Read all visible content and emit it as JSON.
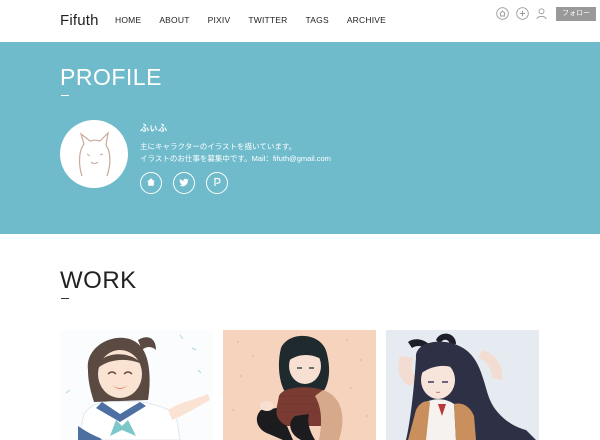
{
  "header": {
    "brand": "Fifuth",
    "nav": [
      "HOME",
      "ABOUT",
      "PIXIV",
      "TWITTER",
      "TAGS",
      "ARCHIVE"
    ],
    "tools": [
      "home-icon",
      "plus-circle-icon",
      "user-icon"
    ],
    "follow_label": "フォロー"
  },
  "profile": {
    "title": "PROFILE",
    "name": "ふぃふ",
    "description_line1": "主にキャラクターのイラストを描いています。",
    "description_line2": "イラストのお仕事を募集中です。Mail：fifuth@gmail.com",
    "social_icons": [
      "home-icon",
      "twitter-icon",
      "pixiv-icon"
    ],
    "accent_color": "#6fbbcc"
  },
  "work": {
    "title": "WORK",
    "items": [
      "illustration-sailor-uniform-girl",
      "illustration-girl-in-sweater",
      "illustration-bunny-ears-girl"
    ]
  }
}
